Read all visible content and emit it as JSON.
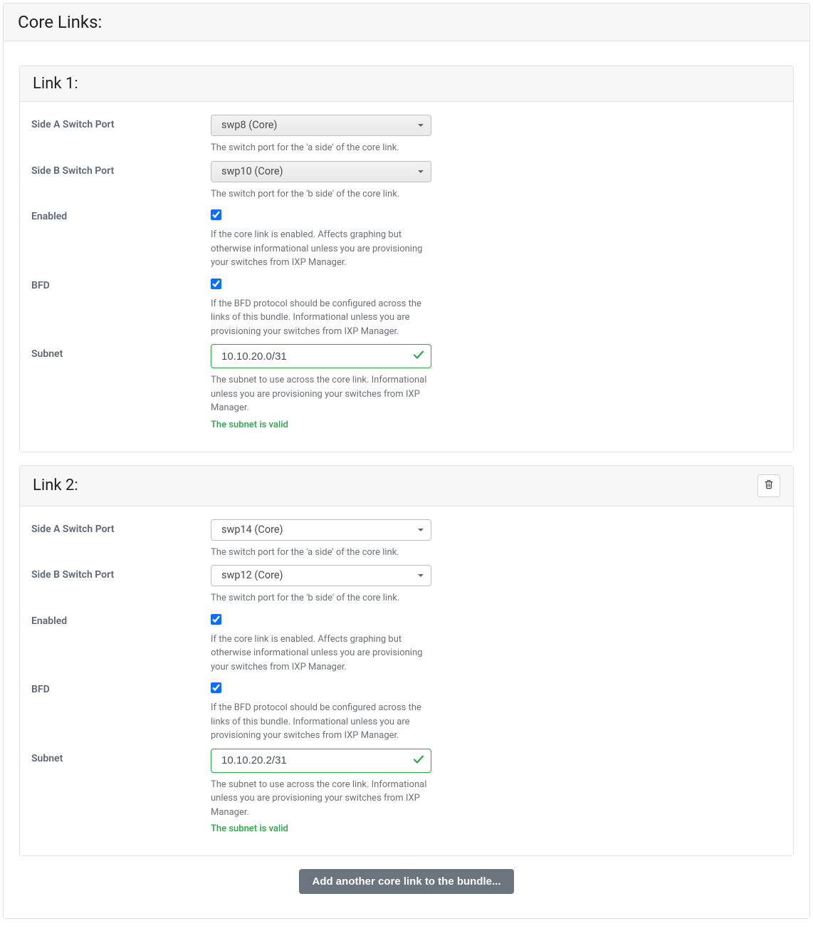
{
  "main_title": "Core Links:",
  "labels": {
    "side_a": "Side A Switch Port",
    "side_b": "Side B Switch Port",
    "enabled": "Enabled",
    "bfd": "BFD",
    "subnet": "Subnet"
  },
  "help": {
    "side_a": "The switch port for the 'a side' of the core link.",
    "side_b": "The switch port for the 'b side' of the core link.",
    "enabled": "If the core link is enabled. Affects graphing but otherwise informational unless you are provisioning your switches from IXP Manager.",
    "bfd": "If the BFD protocol should be configured across the links of this bundle. Informational unless you are provisioning your switches from IXP Manager.",
    "subnet": "The subnet to use across the core link. Informational unless you are provisioning your switches from IXP Manager."
  },
  "links": [
    {
      "title": "Link 1:",
      "side_a": "swp8 (Core)",
      "side_b": "swp10 (Core)",
      "enabled": true,
      "bfd": true,
      "subnet": "10.10.20.0/31",
      "subnet_valid_msg": "The subnet is valid",
      "select_style": "grey",
      "deletable": false
    },
    {
      "title": "Link 2:",
      "side_a": "swp14 (Core)",
      "side_b": "swp12 (Core)",
      "enabled": true,
      "bfd": true,
      "subnet": "10.10.20.2/31",
      "subnet_valid_msg": "The subnet is valid",
      "select_style": "white",
      "deletable": true
    }
  ],
  "add_button": "Add another core link to the bundle..."
}
